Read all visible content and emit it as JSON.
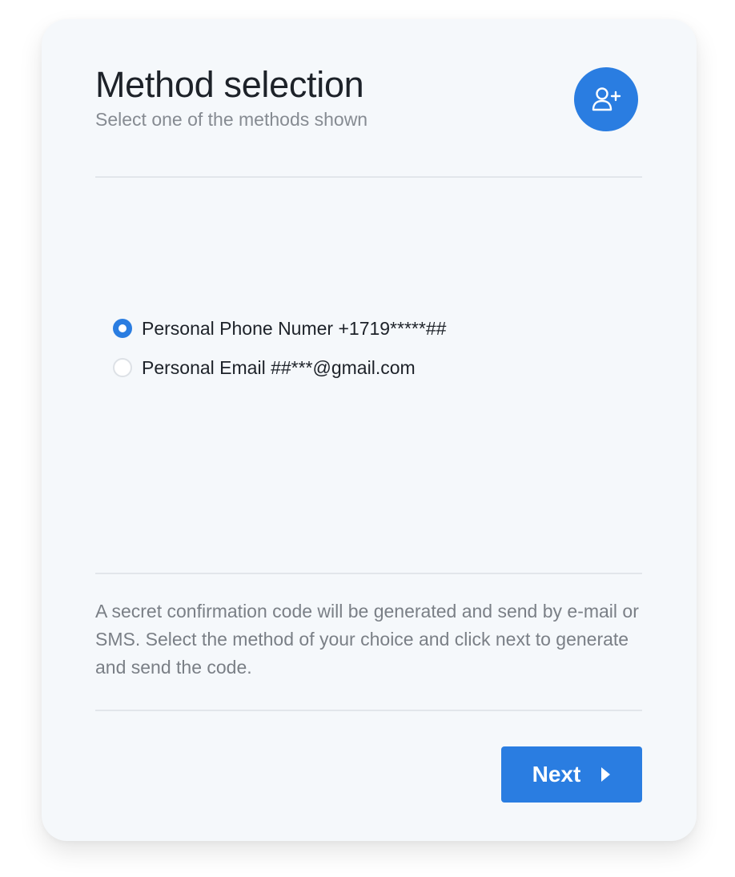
{
  "header": {
    "title": "Method selection",
    "subtitle": "Select one of the methods shown",
    "icon": "user-plus-icon"
  },
  "options": [
    {
      "label": "Personal Phone Numer +1719*****##",
      "selected": true
    },
    {
      "label": "Personal Email ##***@gmail.com",
      "selected": false
    }
  ],
  "info_text": "A secret confirmation code will be generated and send by e-mail or SMS. Select the method of your choice and click next to generate and send the code.",
  "footer": {
    "next_label": "Next",
    "next_icon": "caret-right-icon"
  },
  "colors": {
    "accent": "#2a7de1",
    "card_background": "#f5f8fb",
    "title_text": "#1d2229",
    "muted_text": "#868b92"
  }
}
